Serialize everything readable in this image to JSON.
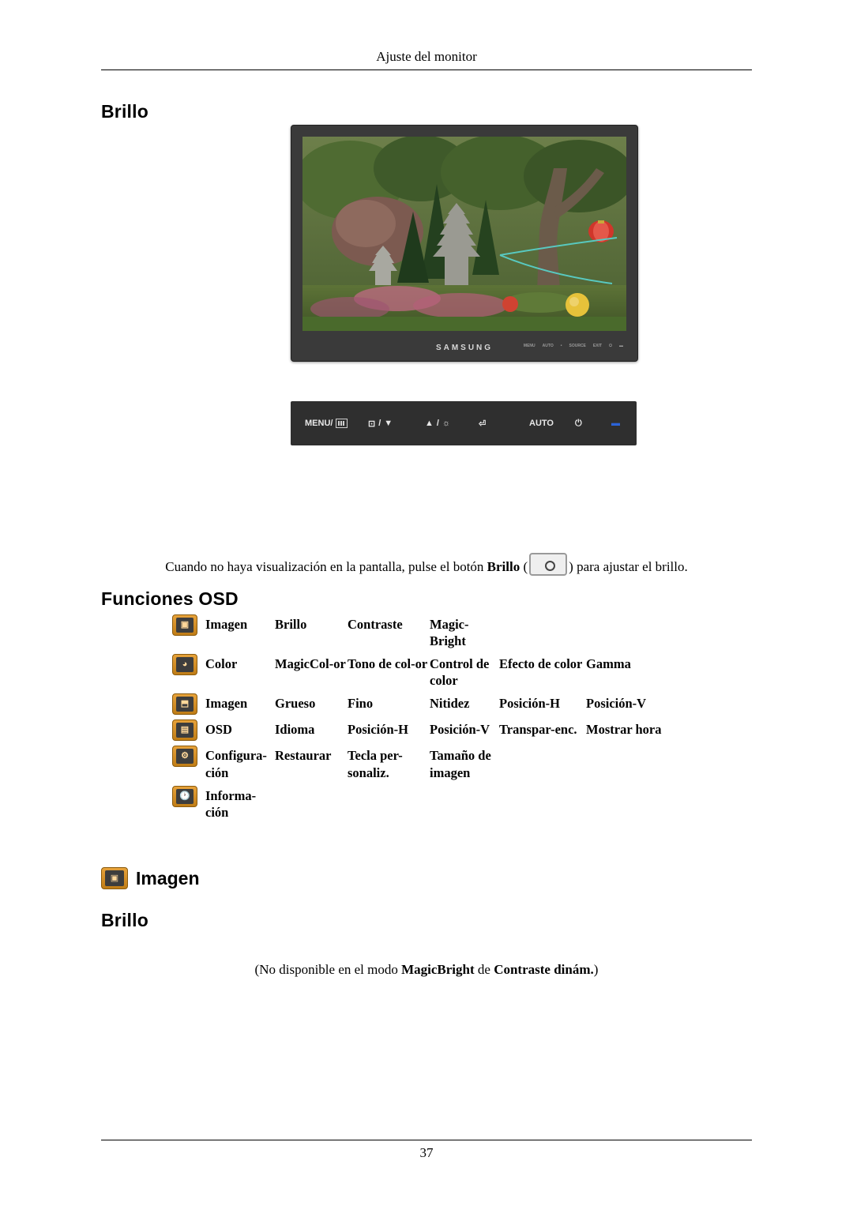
{
  "header": {
    "running_head": "Ajuste del monitor"
  },
  "footer": {
    "page_number": "37"
  },
  "headings": {
    "brillo_1": "Brillo",
    "funciones_osd": "Funciones OSD",
    "imagen": "Imagen",
    "brillo_2": "Brillo"
  },
  "monitor": {
    "brand": "SAMSUNG",
    "panel_buttons": [
      "MENU",
      "AUTO",
      "SOURCE",
      "EXIT",
      "POWER"
    ]
  },
  "control_strip": {
    "menu_label": "MENU/",
    "brightness_label": "/",
    "up_label": "/",
    "enter_label": "",
    "auto_label": "AUTO",
    "power_label": "",
    "source_label": ""
  },
  "paragraph": {
    "before": "Cuando no haya visualización en la pantalla, pulse el botón ",
    "bold": "Brillo",
    "open_paren": "(",
    "close_paren": ")",
    "after": " para ajustar el brillo."
  },
  "osd_table": {
    "rows": [
      {
        "icon": "imagen-icon",
        "cells": [
          "Imagen",
          "Brillo",
          "Contraste",
          "Magic-Bright",
          "",
          ""
        ]
      },
      {
        "icon": "color-icon",
        "cells": [
          "Color",
          "MagicCol-or",
          "Tono de col-or",
          "Control de color",
          "Efecto de color",
          "Gamma"
        ]
      },
      {
        "icon": "pantalla-icon",
        "cells": [
          "Imagen",
          "Grueso",
          "Fino",
          "Nitidez",
          "Posición-H",
          "Posición-V"
        ]
      },
      {
        "icon": "osd-icon",
        "cells": [
          "OSD",
          "Idioma",
          "Posición-H",
          "Posición-V",
          "Transpar-enc.",
          "Mostrar hora"
        ]
      },
      {
        "icon": "configuracion-icon",
        "cells": [
          "Configura-ción",
          "Restaurar",
          "Tecla per-sonaliz.",
          "Tamaño de imagen",
          "",
          ""
        ]
      },
      {
        "icon": "informacion-icon",
        "cells": [
          "Informa-ción",
          "",
          "",
          "",
          "",
          ""
        ]
      }
    ]
  },
  "note": {
    "p1": "(No disponible en el modo ",
    "b1": "MagicBright",
    "p2": " de ",
    "b2": "Contraste dinám.",
    "p3": ")"
  }
}
